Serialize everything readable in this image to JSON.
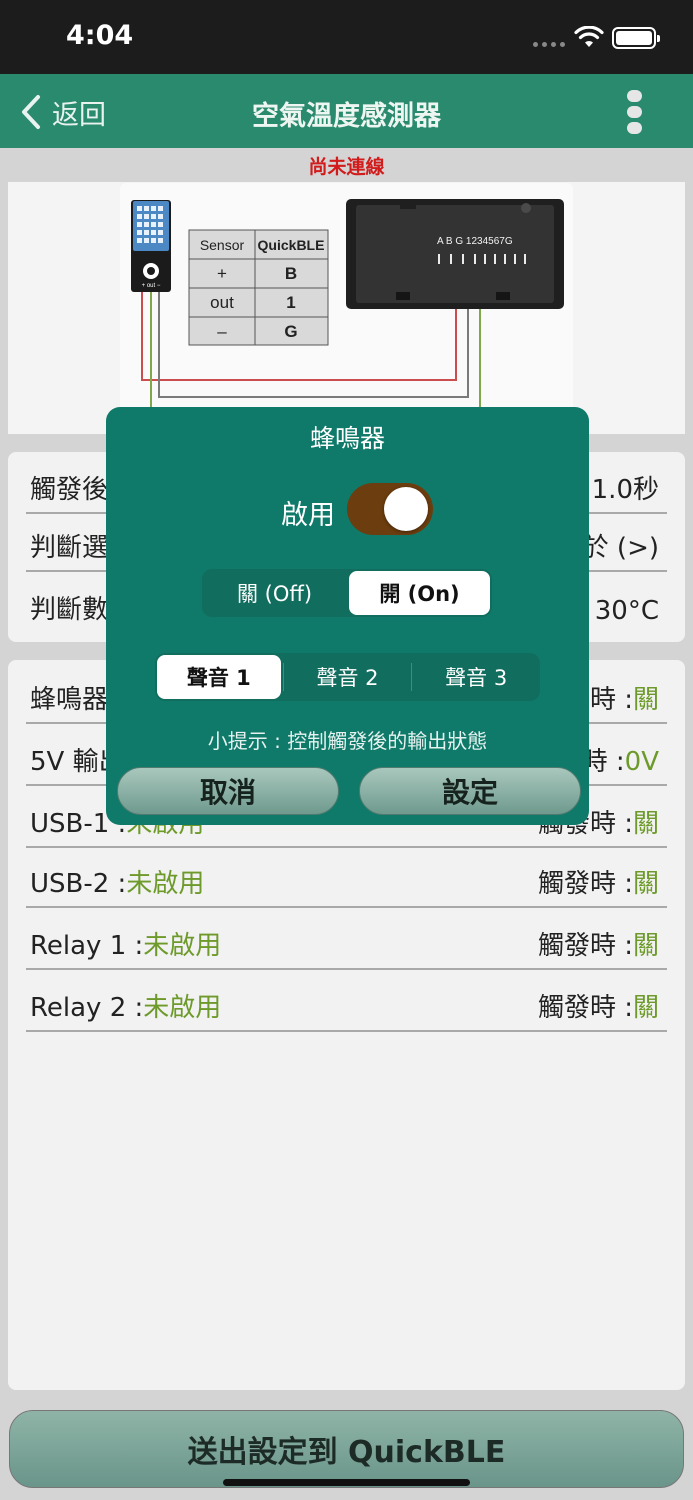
{
  "status": {
    "time": "4:04"
  },
  "nav": {
    "back_label": "返回",
    "title": "空氣溫度感測器"
  },
  "connection_status": "尚未連線",
  "diagram": {
    "table_headers": [
      "Sensor",
      "QuickBLE"
    ],
    "table_rows": [
      [
        "+",
        "B"
      ],
      [
        "out",
        "1"
      ],
      [
        "–",
        "G"
      ]
    ],
    "pin_labels": "A B G 1234567G",
    "sensor_pins": "+ out −"
  },
  "settings": {
    "trigger_after": {
      "label": "觸發後",
      "value": "1.0秒"
    },
    "judge_condition": {
      "label": "判斷選",
      "value": "於 (>)"
    },
    "judge_value": {
      "label": "判斷數",
      "value": "30°C"
    }
  },
  "outputs": [
    {
      "name": "蜂鳴器",
      "status": "",
      "trigger_label": "時 :",
      "trigger_value": "關"
    },
    {
      "name": "5V 輸出",
      "status": "",
      "trigger_label": "時 :",
      "trigger_value": "0V"
    },
    {
      "name": "USB-1 :",
      "status": "未啟用",
      "trigger_label": "觸發時 :",
      "trigger_value": "關"
    },
    {
      "name": "USB-2 :",
      "status": "未啟用",
      "trigger_label": "觸發時 :",
      "trigger_value": "關"
    },
    {
      "name": "Relay 1 :",
      "status": "未啟用",
      "trigger_label": "觸發時 :",
      "trigger_value": "關"
    },
    {
      "name": "Relay 2 :",
      "status": "未啟用",
      "trigger_label": "觸發時 :",
      "trigger_value": "關"
    }
  ],
  "send_button": "送出設定到 QuickBLE",
  "dialog": {
    "title": "蜂鳴器",
    "enable_label": "啟用",
    "enabled": true,
    "onoff": [
      {
        "label": "關 (Off)",
        "active": false
      },
      {
        "label": "開 (On)",
        "active": true
      }
    ],
    "sounds": [
      {
        "label": "聲音 1",
        "active": true
      },
      {
        "label": "聲音 2",
        "active": false
      },
      {
        "label": "聲音 3",
        "active": false
      }
    ],
    "hint": "小提示 : 控制觸發後的輸出狀態",
    "cancel": "取消",
    "confirm": "設定"
  },
  "colors": {
    "nav": "#2a8a6e",
    "dialog": "#0f7a6a",
    "value_green": "#6d9a2a",
    "alert_red": "#d21b1b",
    "toggle_on": "#6b3d0f"
  }
}
